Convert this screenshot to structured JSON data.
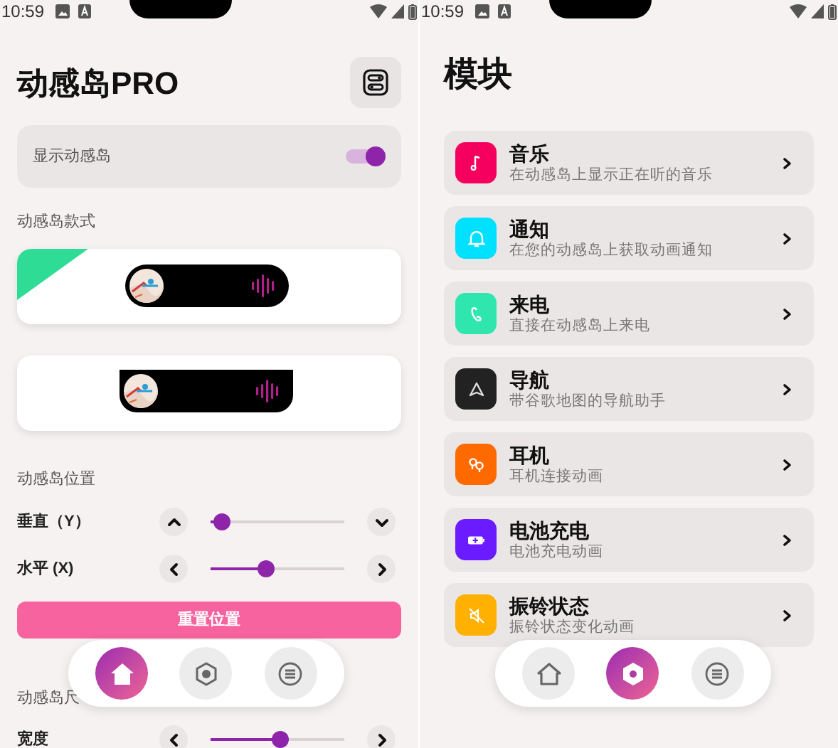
{
  "home_screen": {
    "status_bar": {
      "time": "10:59"
    },
    "title": "动感岛PRO",
    "show_island": {
      "label": "显示动感岛",
      "on": true
    },
    "style_section": {
      "heading": "动感岛款式",
      "styles": [
        {
          "kind": "pill",
          "selected": true
        },
        {
          "kind": "notch",
          "selected": false
        }
      ]
    },
    "position_section": {
      "heading": "动感岛位置",
      "controls": [
        {
          "label": "垂直（Y）",
          "kind": "vertical",
          "level": 0.03
        },
        {
          "label": "水平 (X)",
          "kind": "horizontal",
          "level": 0.4
        }
      ],
      "reset_button": "重置位置"
    },
    "size_section": {
      "heading": "动感岛尺",
      "controls": [
        {
          "label": "宽度",
          "kind": "horizontal",
          "level": 0.52
        }
      ]
    },
    "nav": [
      {
        "kind": "home",
        "selected": true
      },
      {
        "kind": "module",
        "selected": false
      },
      {
        "kind": "menu",
        "selected": false
      }
    ]
  },
  "modules_screen": {
    "status_bar": {
      "time": "10:59"
    },
    "title": "模块",
    "modules": [
      {
        "kind": "music",
        "title": "音乐",
        "subtitle": "在动感岛上显示正在听的音乐",
        "color": "#f5005f"
      },
      {
        "kind": "bell",
        "title": "通知",
        "subtitle": "在您的动感岛上获取动画通知",
        "color": "#00e0ff"
      },
      {
        "kind": "phone",
        "title": "来电",
        "subtitle": "直接在动感岛上来电",
        "color": "#2ee6ae"
      },
      {
        "kind": "navigation",
        "title": "导航",
        "subtitle": "带谷歌地图的导航助手",
        "color": "#222222"
      },
      {
        "kind": "earbuds",
        "title": "耳机",
        "subtitle": "耳机连接动画",
        "color": "#ff6a00"
      },
      {
        "kind": "battery",
        "title": "电池充电",
        "subtitle": "电池充电动画",
        "color": "#6a1bff"
      },
      {
        "kind": "mute",
        "title": "振铃状态",
        "subtitle": "振铃状态变化动画",
        "color": "#ffb000"
      }
    ],
    "nav": [
      {
        "kind": "home",
        "selected": false
      },
      {
        "kind": "module",
        "selected": true
      },
      {
        "kind": "menu",
        "selected": false
      }
    ]
  }
}
